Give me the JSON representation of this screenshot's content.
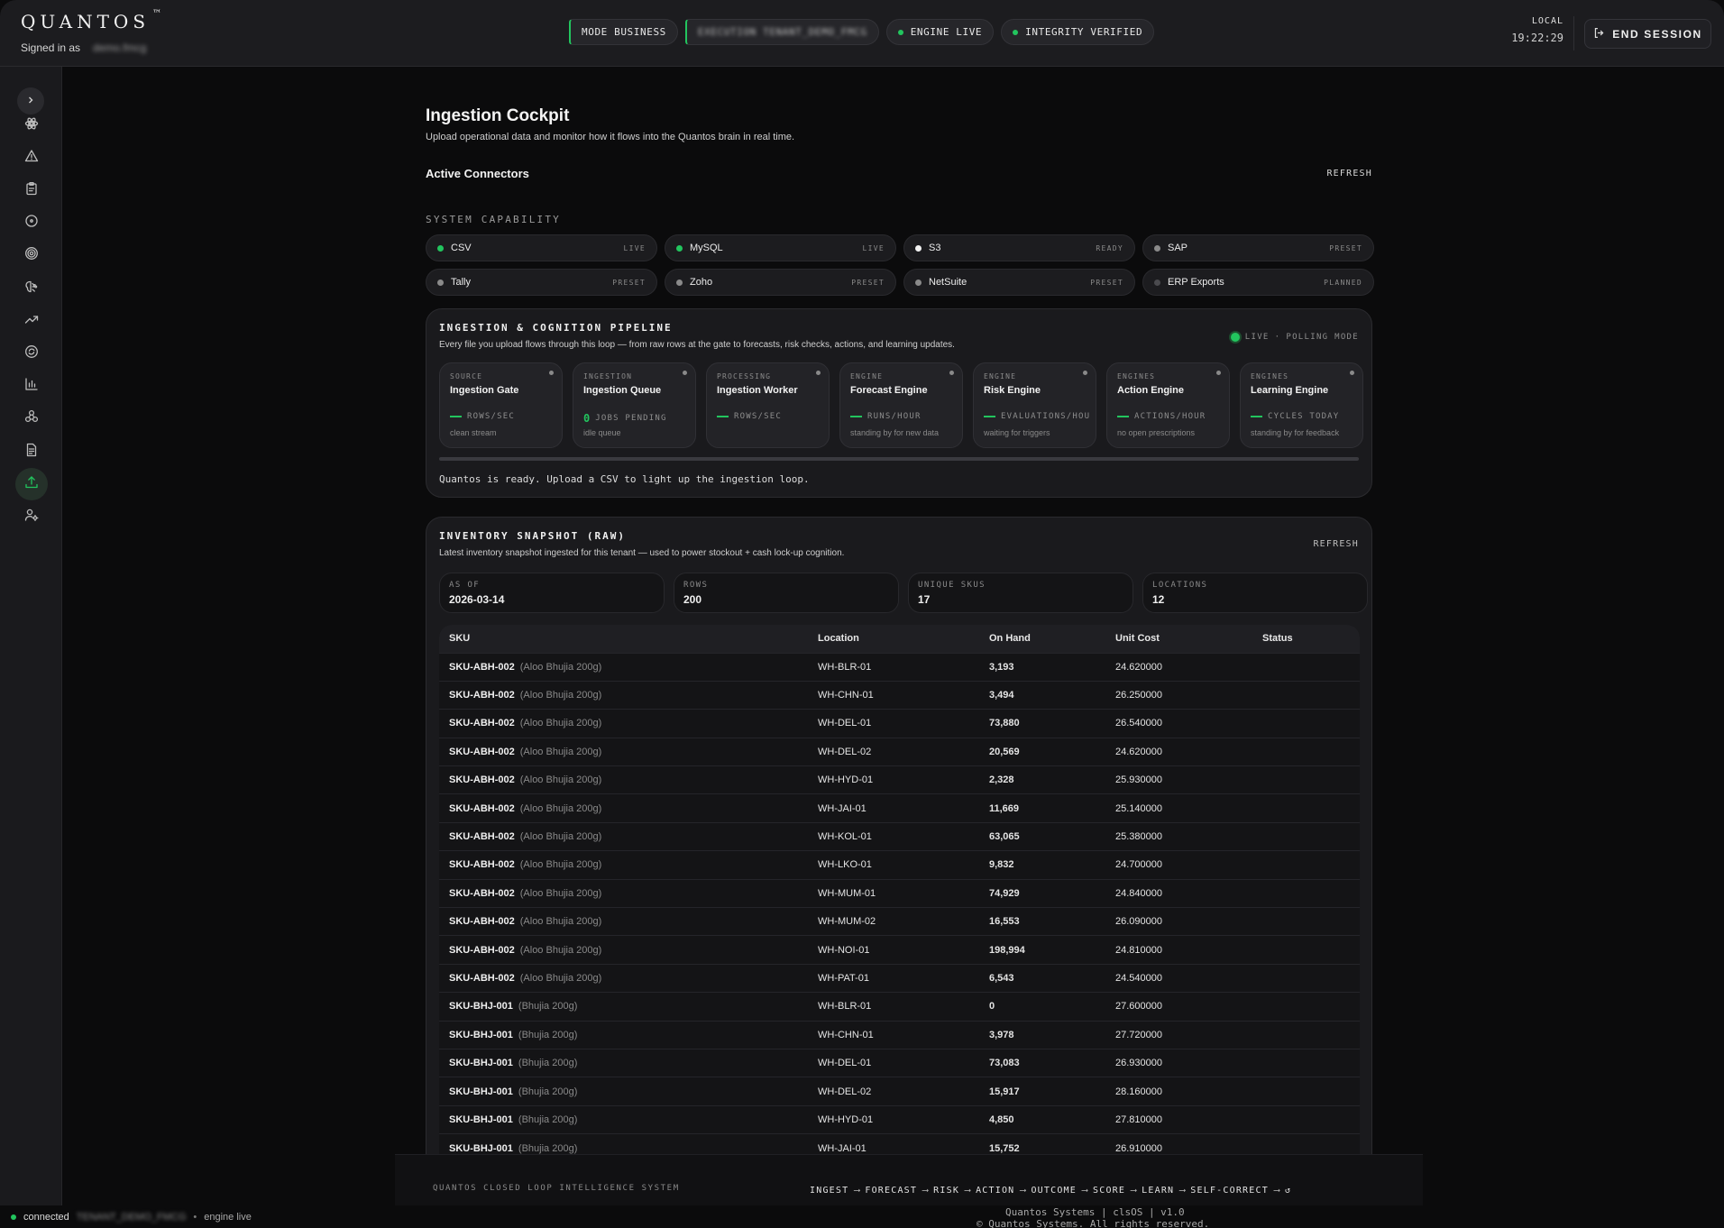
{
  "header": {
    "brand": "QUANTOS",
    "brand_mark": "™",
    "signed_in_label": "Signed in as",
    "signed_in_user": "demo.fmcg",
    "pills": [
      {
        "label": "MODE BUSINESS",
        "style": "bar"
      },
      {
        "label": "EXECUTION TENANT_DEMO_FMCG",
        "style": "bar-blur"
      },
      {
        "label": "ENGINE LIVE",
        "style": "dot"
      },
      {
        "label": "INTEGRITY VERIFIED",
        "style": "dot"
      }
    ],
    "clock_label": "LOCAL",
    "clock_time": "19:22:29",
    "end_session_label": "END SESSION"
  },
  "sidebar": {
    "items": [
      {
        "icon": "atom-icon",
        "active": false
      },
      {
        "icon": "alert-icon",
        "active": false
      },
      {
        "icon": "clipboard-icon",
        "active": false
      },
      {
        "icon": "circle-dot-icon",
        "active": false
      },
      {
        "icon": "target-icon",
        "active": false
      },
      {
        "icon": "brain-icon",
        "active": false
      },
      {
        "icon": "trend-icon",
        "active": false
      },
      {
        "icon": "refresh-circle-icon",
        "active": false
      },
      {
        "icon": "bar-chart-icon",
        "active": false
      },
      {
        "icon": "network-icon",
        "active": false
      },
      {
        "icon": "document-icon",
        "active": false
      },
      {
        "icon": "upload-icon",
        "active": true
      },
      {
        "icon": "user-settings-icon",
        "active": false
      }
    ]
  },
  "page": {
    "title": "Ingestion Cockpit",
    "subtitle": "Upload operational data and monitor how it flows into the Quantos brain in real time.",
    "connectors_heading": "Active Connectors",
    "refresh_label": "REFRESH",
    "capability_label": "SYSTEM CAPABILITY"
  },
  "connectors": [
    {
      "name": "CSV",
      "status": "LIVE",
      "color": "#22c55e"
    },
    {
      "name": "MySQL",
      "status": "LIVE",
      "color": "#22c55e"
    },
    {
      "name": "S3",
      "status": "READY",
      "color": "#f2f2f2"
    },
    {
      "name": "SAP",
      "status": "PRESET",
      "color": "#8a8a8a"
    },
    {
      "name": "Tally",
      "status": "PRESET",
      "color": "#8a8a8a"
    },
    {
      "name": "Zoho",
      "status": "PRESET",
      "color": "#8a8a8a"
    },
    {
      "name": "NetSuite",
      "status": "PRESET",
      "color": "#8a8a8a"
    },
    {
      "name": "ERP Exports",
      "status": "PLANNED",
      "color": "#4a4a4e"
    }
  ],
  "pipeline": {
    "title": "INGESTION & COGNITION PIPELINE",
    "description": "Every file you upload flows through this loop — from raw rows at the gate to forecasts, risk checks, actions, and learning updates.",
    "live_label": "LIVE",
    "mode_sep": "·",
    "mode_label": "POLLING MODE",
    "ready_message": "Quantos is ready. Upload a CSV to light up the ingestion loop.",
    "stages": [
      {
        "category": "SOURCE",
        "name": "Ingestion Gate",
        "value": "",
        "unit": "ROWS/SEC",
        "hint": "clean stream"
      },
      {
        "category": "INGESTION",
        "name": "Ingestion Queue",
        "value": "0",
        "unit": "JOBS PENDING",
        "hint": "idle queue"
      },
      {
        "category": "PROCESSING",
        "name": "Ingestion Worker",
        "value": "",
        "unit": "ROWS/SEC",
        "hint": ""
      },
      {
        "category": "ENGINE",
        "name": "Forecast Engine",
        "value": "",
        "unit": "RUNS/HOUR",
        "hint": "standing by for new data"
      },
      {
        "category": "ENGINE",
        "name": "Risk Engine",
        "value": "",
        "unit": "EVALUATIONS/HOU",
        "hint": "waiting for triggers"
      },
      {
        "category": "ENGINES",
        "name": "Action Engine",
        "value": "",
        "unit": "ACTIONS/HOUR",
        "hint": "no open prescriptions"
      },
      {
        "category": "ENGINES",
        "name": "Learning Engine",
        "value": "",
        "unit": "CYCLES TODAY",
        "hint": "standing by for feedback"
      }
    ]
  },
  "inventory": {
    "title": "INVENTORY SNAPSHOT (RAW)",
    "description": "Latest inventory snapshot ingested for this tenant — used to power stockout + cash lock-up cognition.",
    "refresh_label": "REFRESH",
    "stats": [
      {
        "label": "AS OF",
        "value": "2026-03-14"
      },
      {
        "label": "ROWS",
        "value": "200"
      },
      {
        "label": "UNIQUE SKUS",
        "value": "17"
      },
      {
        "label": "LOCATIONS",
        "value": "12"
      }
    ],
    "columns": [
      "SKU",
      "Location",
      "On Hand",
      "Unit Cost",
      "Status"
    ],
    "rows": [
      {
        "sku": "SKU-ABH-002",
        "desc": "(Aloo Bhujia 200g)",
        "location": "WH-BLR-01",
        "on_hand": "3,193",
        "unit_cost": "24.620000",
        "status": ""
      },
      {
        "sku": "SKU-ABH-002",
        "desc": "(Aloo Bhujia 200g)",
        "location": "WH-CHN-01",
        "on_hand": "3,494",
        "unit_cost": "26.250000",
        "status": ""
      },
      {
        "sku": "SKU-ABH-002",
        "desc": "(Aloo Bhujia 200g)",
        "location": "WH-DEL-01",
        "on_hand": "73,880",
        "unit_cost": "26.540000",
        "status": ""
      },
      {
        "sku": "SKU-ABH-002",
        "desc": "(Aloo Bhujia 200g)",
        "location": "WH-DEL-02",
        "on_hand": "20,569",
        "unit_cost": "24.620000",
        "status": ""
      },
      {
        "sku": "SKU-ABH-002",
        "desc": "(Aloo Bhujia 200g)",
        "location": "WH-HYD-01",
        "on_hand": "2,328",
        "unit_cost": "25.930000",
        "status": ""
      },
      {
        "sku": "SKU-ABH-002",
        "desc": "(Aloo Bhujia 200g)",
        "location": "WH-JAI-01",
        "on_hand": "11,669",
        "unit_cost": "25.140000",
        "status": ""
      },
      {
        "sku": "SKU-ABH-002",
        "desc": "(Aloo Bhujia 200g)",
        "location": "WH-KOL-01",
        "on_hand": "63,065",
        "unit_cost": "25.380000",
        "status": ""
      },
      {
        "sku": "SKU-ABH-002",
        "desc": "(Aloo Bhujia 200g)",
        "location": "WH-LKO-01",
        "on_hand": "9,832",
        "unit_cost": "24.700000",
        "status": ""
      },
      {
        "sku": "SKU-ABH-002",
        "desc": "(Aloo Bhujia 200g)",
        "location": "WH-MUM-01",
        "on_hand": "74,929",
        "unit_cost": "24.840000",
        "status": ""
      },
      {
        "sku": "SKU-ABH-002",
        "desc": "(Aloo Bhujia 200g)",
        "location": "WH-MUM-02",
        "on_hand": "16,553",
        "unit_cost": "26.090000",
        "status": ""
      },
      {
        "sku": "SKU-ABH-002",
        "desc": "(Aloo Bhujia 200g)",
        "location": "WH-NOI-01",
        "on_hand": "198,994",
        "unit_cost": "24.810000",
        "status": ""
      },
      {
        "sku": "SKU-ABH-002",
        "desc": "(Aloo Bhujia 200g)",
        "location": "WH-PAT-01",
        "on_hand": "6,543",
        "unit_cost": "24.540000",
        "status": ""
      },
      {
        "sku": "SKU-BHJ-001",
        "desc": "(Bhujia 200g)",
        "location": "WH-BLR-01",
        "on_hand": "0",
        "unit_cost": "27.600000",
        "status": ""
      },
      {
        "sku": "SKU-BHJ-001",
        "desc": "(Bhujia 200g)",
        "location": "WH-CHN-01",
        "on_hand": "3,978",
        "unit_cost": "27.720000",
        "status": ""
      },
      {
        "sku": "SKU-BHJ-001",
        "desc": "(Bhujia 200g)",
        "location": "WH-DEL-01",
        "on_hand": "73,083",
        "unit_cost": "26.930000",
        "status": ""
      },
      {
        "sku": "SKU-BHJ-001",
        "desc": "(Bhujia 200g)",
        "location": "WH-DEL-02",
        "on_hand": "15,917",
        "unit_cost": "28.160000",
        "status": ""
      },
      {
        "sku": "SKU-BHJ-001",
        "desc": "(Bhujia 200g)",
        "location": "WH-HYD-01",
        "on_hand": "4,850",
        "unit_cost": "27.810000",
        "status": ""
      },
      {
        "sku": "SKU-BHJ-001",
        "desc": "(Bhujia 200g)",
        "location": "WH-JAI-01",
        "on_hand": "15,752",
        "unit_cost": "26.910000",
        "status": ""
      }
    ]
  },
  "footer": {
    "system_name": "QUANTOS CLOSED LOOP INTELLIGENCE SYSTEM",
    "loop_steps": [
      "INGEST",
      "FORECAST",
      "RISK",
      "ACTION",
      "OUTCOME",
      "SCORE",
      "LEARN",
      "SELF-CORRECT"
    ],
    "loop_arrow": "⟶",
    "loop_end": "↺",
    "version_line": "Quantos Systems | clsOS | v1.0",
    "copyright_line": "© Quantos Systems. All rights reserved."
  },
  "statusbar": {
    "connection": "connected",
    "tenant": "TENANT_DEMO_FMCG",
    "separator": "•",
    "engine": "engine live"
  },
  "colors": {
    "accent": "#22c55e",
    "background": "#0b0b0c",
    "panel": "#1a1a1d"
  }
}
